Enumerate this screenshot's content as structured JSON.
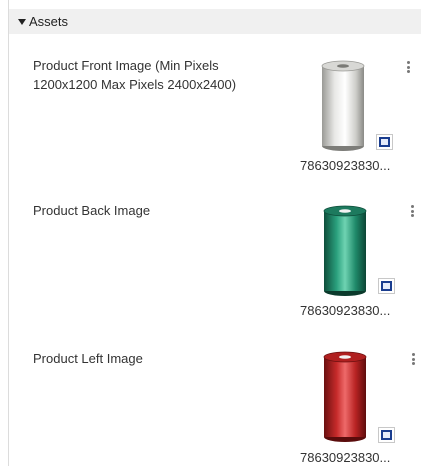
{
  "section": {
    "title": "Assets",
    "caret_icon": "caret-down-icon"
  },
  "assets": [
    {
      "label": "Product Front Image (Min Pixels 1200x1200 Max Pixels 2400x2400)",
      "filename": "78630923830...",
      "spool_color": "#c9c9c6",
      "menu_icon": "kebab-menu-icon"
    },
    {
      "label": "Product Back Image",
      "filename": "78630923830...",
      "spool_color": "#1f8a6a",
      "menu_icon": "kebab-menu-icon"
    },
    {
      "label": "Product Left Image",
      "filename": "78630923830...",
      "spool_color": "#c62a2a",
      "menu_icon": "kebab-menu-icon"
    }
  ]
}
